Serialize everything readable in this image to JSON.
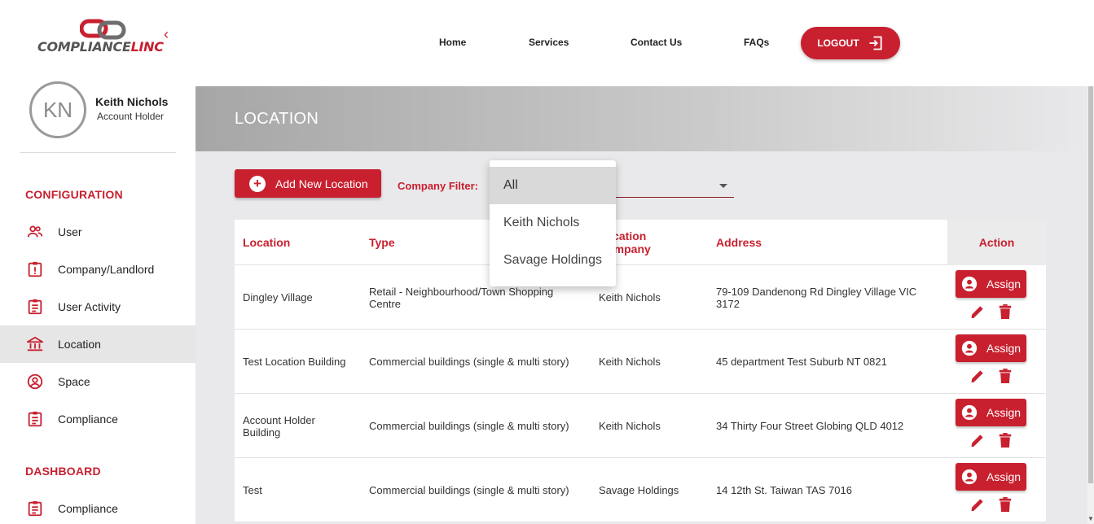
{
  "brand": {
    "logo_main": "COMPLIANCE",
    "logo_accent": "LINC",
    "collapse_glyph": "‹"
  },
  "user": {
    "initials": "KN",
    "name": "Keith Nichols",
    "role": "Account Holder"
  },
  "sidebar": {
    "configuration_title": "CONFIGURATION",
    "configuration_items": [
      {
        "label": "User",
        "icon": "users-icon"
      },
      {
        "label": "Company/Landlord",
        "icon": "alert-clipboard-icon"
      },
      {
        "label": "User Activity",
        "icon": "clipboard-list-icon"
      },
      {
        "label": "Location",
        "icon": "bank-icon",
        "active": true
      },
      {
        "label": "Space",
        "icon": "account-circle-icon"
      },
      {
        "label": "Compliance",
        "icon": "clipboard-list-icon"
      }
    ],
    "dashboard_title": "DASHBOARD",
    "dashboard_items": [
      {
        "label": "Compliance",
        "icon": "clipboard-list-icon"
      }
    ]
  },
  "topnav": {
    "home": "Home",
    "services": "Services",
    "contact": "Contact Us",
    "faqs": "FAQs",
    "logout": "LOGOUT"
  },
  "page": {
    "title": "LOCATION",
    "add_button": "Add New Location",
    "filter_label": "Company Filter:",
    "filter_selected": "All",
    "filter_options": [
      "All",
      "Keith Nichols",
      "Savage Holdings"
    ]
  },
  "table": {
    "headers": {
      "location": "Location",
      "type": "Type",
      "company": "Location Company",
      "address": "Address",
      "action": "Action"
    },
    "assign_label": "Assign",
    "rows": [
      {
        "location": "Dingley Village",
        "type": "Retail - Neighbourhood/Town Shopping Centre",
        "company": "Keith Nichols",
        "address": "79-109 Dandenong Rd Dingley Village VIC 3172"
      },
      {
        "location": "Test Location Building",
        "type": "Commercial buildings (single & multi story)",
        "company": "Keith Nichols",
        "address": "45 department Test Suburb NT 0821"
      },
      {
        "location": "Account Holder Building",
        "type": "Commercial buildings (single & multi story)",
        "company": "Keith Nichols",
        "address": "34 Thirty Four Street Globing QLD 4012"
      },
      {
        "location": "Test",
        "type": "Commercial buildings (single & multi story)",
        "company": "Savage Holdings",
        "address": "14 12th St. Taiwan TAS 7016"
      }
    ]
  },
  "colors": {
    "accent": "#c8202f",
    "panel_bg": "#e9e9eb",
    "active_nav": "#e6e6e6"
  }
}
